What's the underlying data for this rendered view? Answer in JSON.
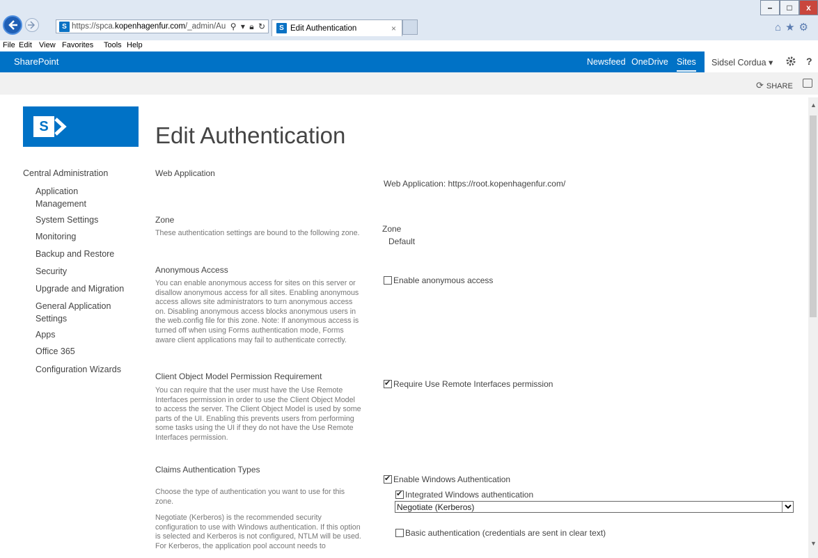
{
  "browser": {
    "url_prefix": "https://spca.",
    "url_domain": "kopenhagenfur.com",
    "url_suffix": "/_admin/Au",
    "tab_title": "Edit Authentication",
    "tab_close": "×",
    "menu": [
      "File",
      "Edit",
      "View",
      "Favorites",
      "Tools",
      "Help"
    ],
    "window_controls": {
      "minimize": "–",
      "maximize": "□",
      "close": "x"
    }
  },
  "suitebar": {
    "brand": "SharePoint",
    "links": [
      "Newsfeed",
      "OneDrive",
      "Sites"
    ],
    "active_link": "Sites",
    "user": "Sidsel Cordua ▾",
    "help": "?"
  },
  "ribbon": {
    "share": "SHARE"
  },
  "page": {
    "title": "Edit Authentication"
  },
  "quicklaunch": {
    "header": "Central Administration",
    "items": [
      "Application Management",
      "System Settings",
      "Monitoring",
      "Backup and Restore",
      "Security",
      "Upgrade and Migration",
      "General Application Settings",
      "Apps",
      "Office 365",
      "Configuration Wizards"
    ]
  },
  "sections": {
    "web_app": {
      "title": "Web Application",
      "value": "Web Application: https://root.kopenhagenfur.com/"
    },
    "zone": {
      "title": "Zone",
      "desc": "These authentication settings are bound to the following zone.",
      "label": "Zone",
      "value": "Default"
    },
    "anonymous": {
      "title": "Anonymous Access",
      "desc": "You can enable anonymous access for sites on this server or disallow anonymous access for all sites. Enabling anonymous access allows site administrators to turn anonymous access on. Disabling anonymous access blocks anonymous users in the web.config file for this zone. Note: If anonymous access is turned off when using Forms authentication mode, Forms aware client applications may fail to authenticate correctly.",
      "checkbox_label": "Enable anonymous access",
      "checked": false
    },
    "client_om": {
      "title": "Client Object Model Permission Requirement",
      "desc": "You can require that the user must have the Use Remote Interfaces permission in order to use the Client Object Model to access the server. The Client Object Model is used by some parts of the UI. Enabling this prevents users from performing some tasks using the UI if they do not have the Use Remote Interfaces permission.",
      "checkbox_label": "Require Use Remote Interfaces permission",
      "checked": true
    },
    "claims": {
      "title": "Claims Authentication Types",
      "desc1": "Choose the type of authentication you want to use for this zone.",
      "desc2": "Negotiate (Kerberos) is the recommended security configuration to use with Windows authentication. If this option is selected and Kerberos is not configured, NTLM will be used. For Kerberos, the application pool account needs to",
      "enable_windows_label": "Enable Windows Authentication",
      "enable_windows_checked": true,
      "integrated_label": "Integrated Windows authentication",
      "integrated_checked": true,
      "auth_method": "Negotiate (Kerberos)",
      "basic_label": "Basic authentication (credentials are sent in clear text)",
      "basic_checked": false
    }
  },
  "colors": {
    "suitebar": "#0072c6",
    "ribbon": "#f1f1f1",
    "text": "#444444",
    "muted_text": "#777777"
  }
}
